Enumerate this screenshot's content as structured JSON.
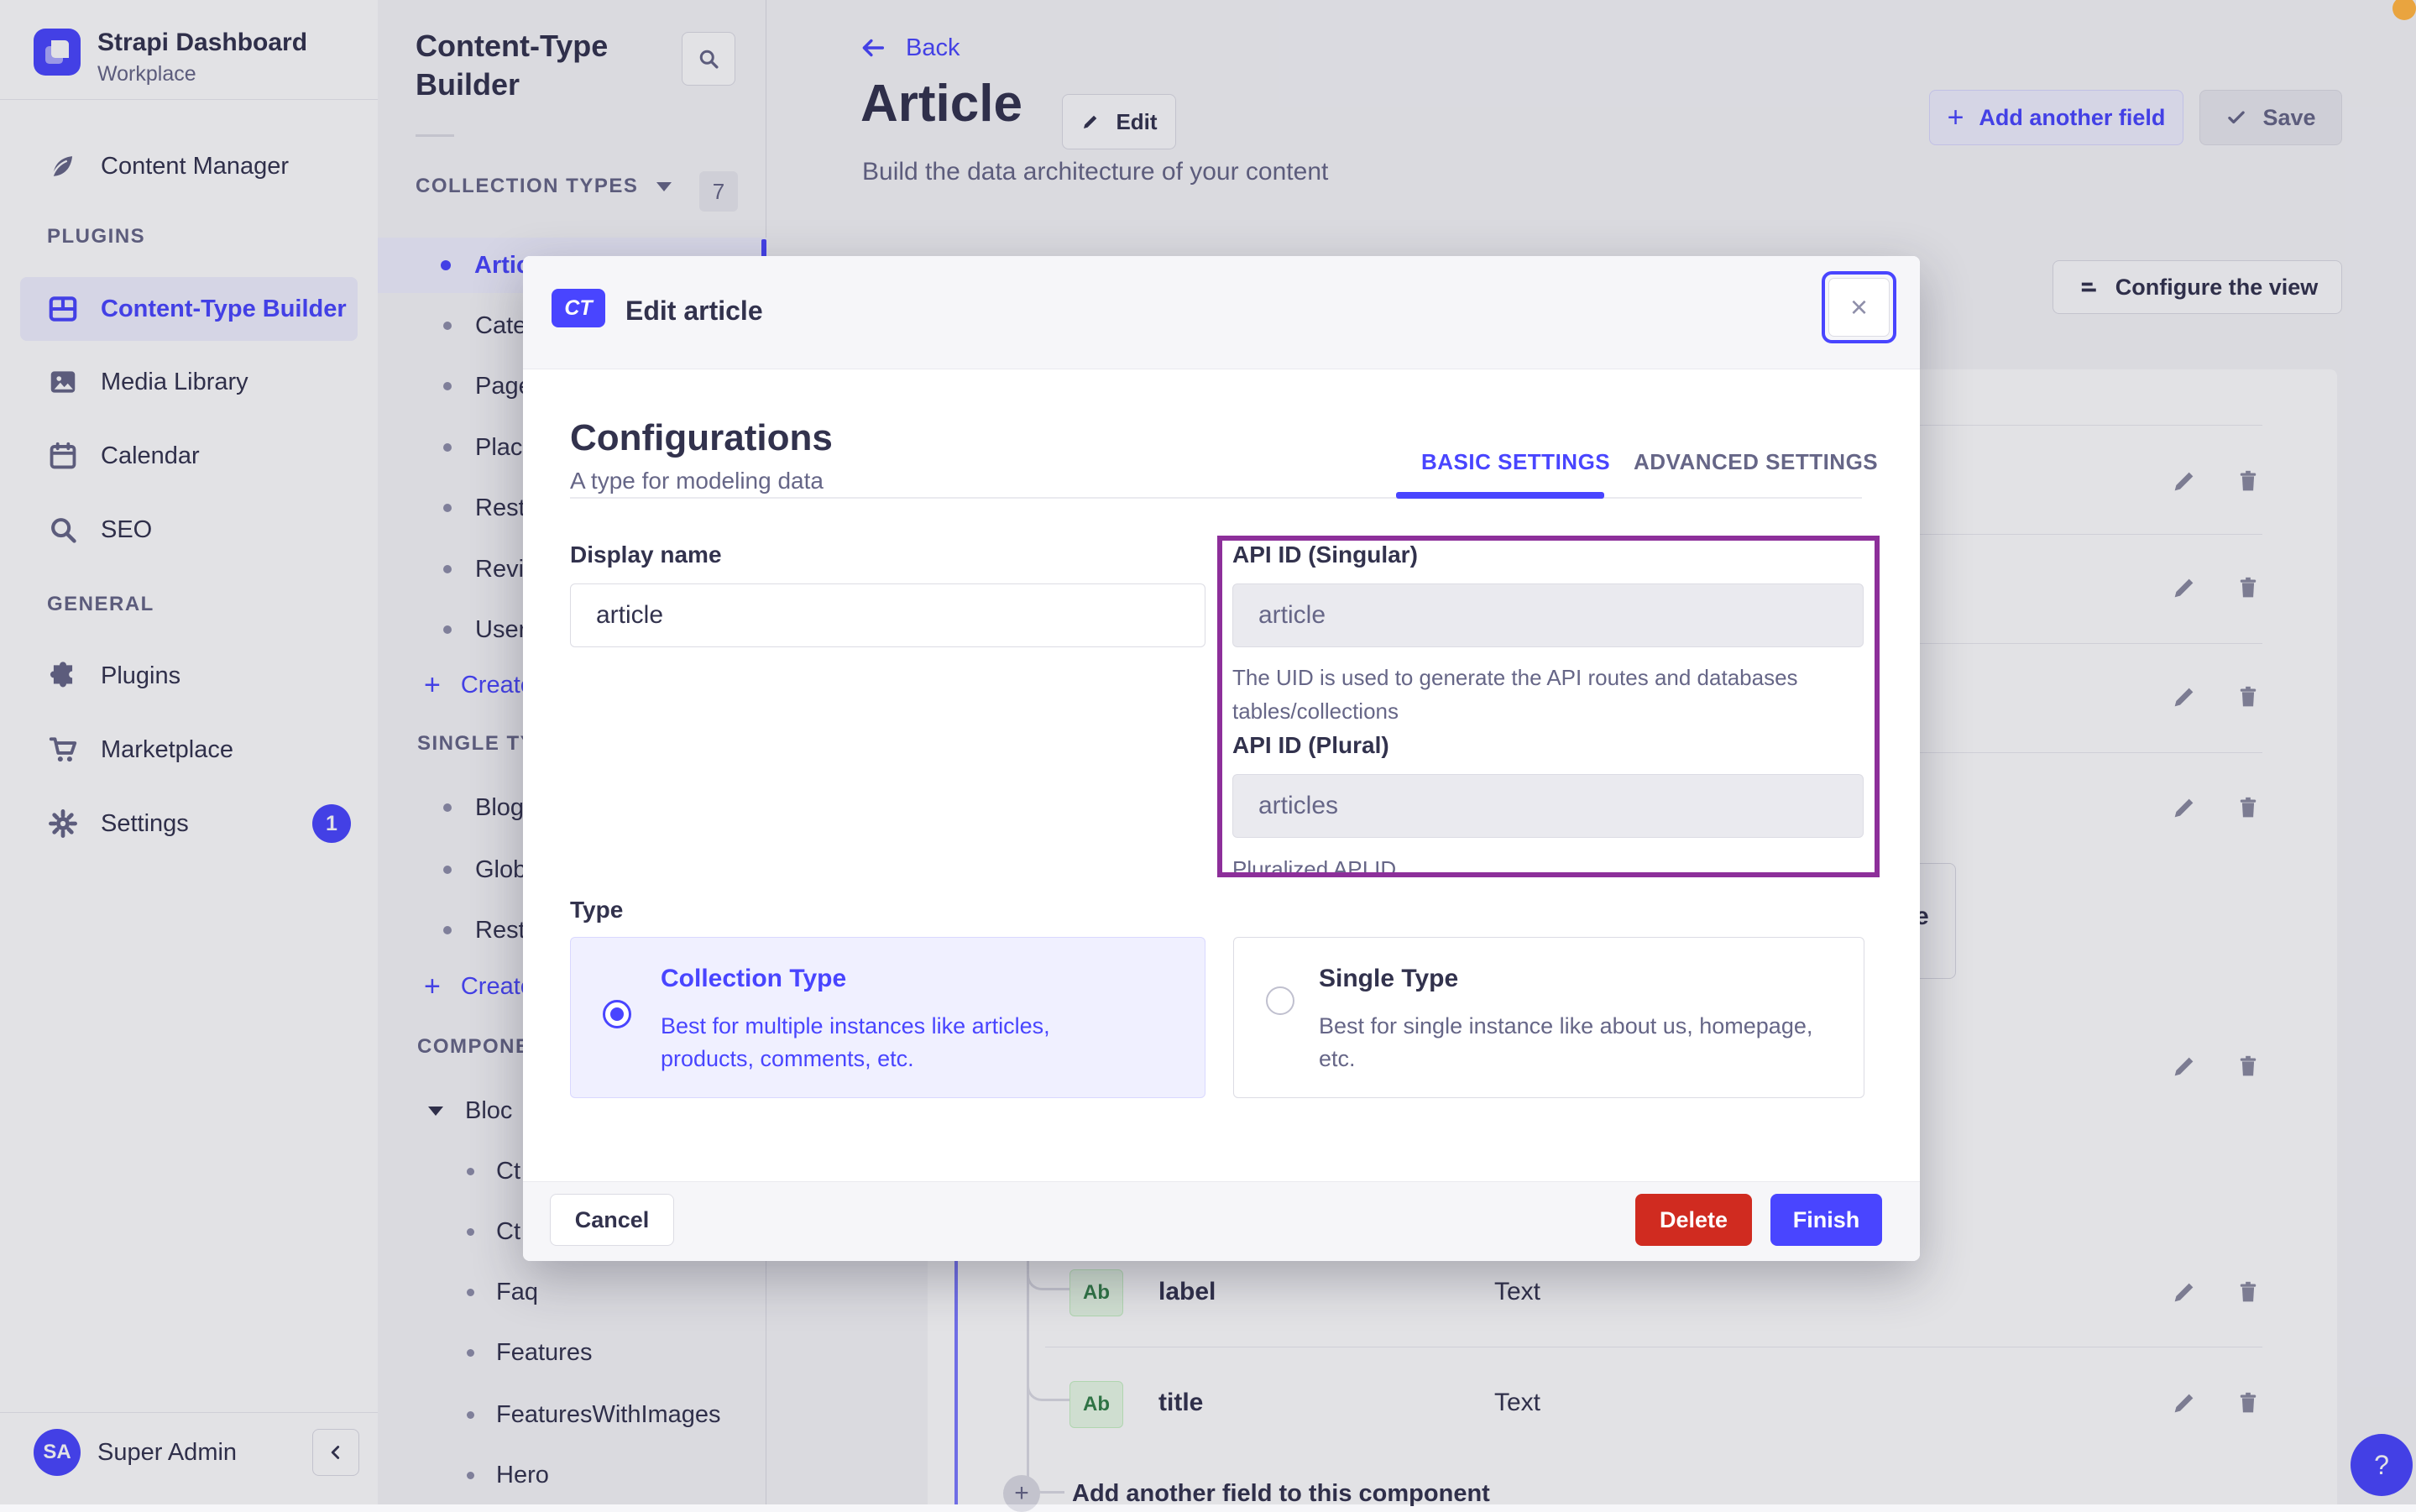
{
  "colors": {
    "accent": "#4945ff",
    "accent_soft": "#f0f0ff",
    "danger": "#d02b20",
    "annotation": "#8d2f9a",
    "recording_dot": "#e9a43f",
    "text": "#32324d",
    "muted": "#666687",
    "badge_green_bg": "#eafbe7",
    "badge_green_text": "#328048"
  },
  "brand": {
    "name": "Strapi Dashboard",
    "workspace": "Workplace"
  },
  "nav": {
    "content_manager": "Content Manager",
    "plugins_section": "PLUGINS",
    "plugins_items": [
      {
        "label": "Content-Type Builder",
        "icon": "layout-grid-icon",
        "active": true
      },
      {
        "label": "Media Library",
        "icon": "picture-icon"
      },
      {
        "label": "Calendar",
        "icon": "calendar-icon"
      },
      {
        "label": "SEO",
        "icon": "search-icon"
      }
    ],
    "general_section": "GENERAL",
    "general_items": [
      {
        "label": "Plugins",
        "icon": "puzzle-icon"
      },
      {
        "label": "Marketplace",
        "icon": "cart-icon"
      },
      {
        "label": "Settings",
        "icon": "gear-icon",
        "badge": "1"
      }
    ],
    "user": {
      "initials": "SA",
      "name": "Super Admin"
    }
  },
  "panel": {
    "title": "Content-Type Builder",
    "collection_header": {
      "label": "COLLECTION TYPES",
      "count": "7"
    },
    "collection_items": [
      "Artic",
      "Cate",
      "Page",
      "Plac",
      "Rest",
      "Revi",
      "User"
    ],
    "create_collection": "Create",
    "single_header": "SINGLE TY",
    "single_items": [
      "Blog",
      "Glob",
      "Rest"
    ],
    "create_single": "Create",
    "components_header": "COMPONE",
    "component_group": "Bloc",
    "component_items": [
      "Ct",
      "Ct",
      "Faq",
      "Features",
      "FeaturesWithImages",
      "Hero"
    ]
  },
  "header": {
    "back": "Back",
    "title": "Article",
    "edit": "Edit",
    "subtitle": "Build the data architecture of your content",
    "add_field": "Add another field",
    "save": "Save",
    "configure": "Configure the view"
  },
  "fields_table": {
    "rows": [
      {
        "badge": "Ab",
        "name": "label",
        "type": "Text"
      },
      {
        "badge": "Ab",
        "name": "title",
        "type": "Text"
      }
    ],
    "add_row": "Add another field to this component",
    "truncated_text": "e"
  },
  "modal": {
    "badge": "CT",
    "title": "Edit article",
    "close": "×",
    "heading": "Configurations",
    "subheading": "A type for modeling data",
    "tabs": [
      "BASIC SETTINGS",
      "ADVANCED SETTINGS"
    ],
    "display_name": {
      "label": "Display name",
      "value": "article"
    },
    "api_singular": {
      "label": "API ID (Singular)",
      "value": "article",
      "help": "The UID is used to generate the API routes and databases tables/collections"
    },
    "api_plural": {
      "label": "API ID (Plural)",
      "value": "articles",
      "help": "Pluralized API ID"
    },
    "type_label": "Type",
    "collection_option": {
      "title": "Collection Type",
      "description": "Best for multiple instances like articles, products, comments, etc.",
      "selected": true
    },
    "single_option": {
      "title": "Single Type",
      "description": "Best for single instance like about us, homepage, etc.",
      "selected": false
    },
    "cancel": "Cancel",
    "delete": "Delete",
    "finish": "Finish"
  },
  "help": "?"
}
